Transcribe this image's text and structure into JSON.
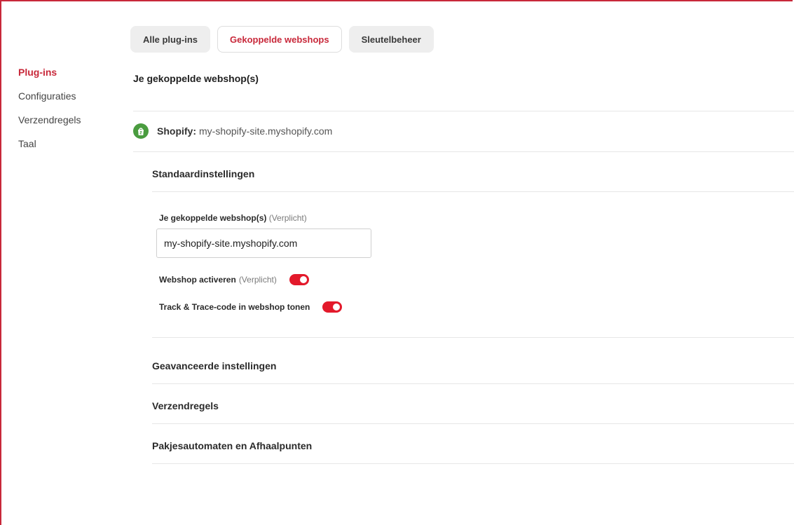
{
  "tabs": [
    {
      "label": "Alle plug-ins",
      "active": false
    },
    {
      "label": "Gekoppelde webshops",
      "active": true
    },
    {
      "label": "Sleutelbeheer",
      "active": false
    }
  ],
  "sidebar": {
    "items": [
      {
        "label": "Plug-ins",
        "active": true
      },
      {
        "label": "Configuraties",
        "active": false
      },
      {
        "label": "Verzendregels",
        "active": false
      },
      {
        "label": "Taal",
        "active": false
      }
    ]
  },
  "main": {
    "title": "Je gekoppelde webshop(s)",
    "shop": {
      "platform": "Shopify:",
      "domain": "my-shopify-site.myshopify.com",
      "icon": "shopify-bag-icon"
    },
    "default_settings": {
      "title": "Standaardinstellingen",
      "webshop_field": {
        "label": "Je gekoppelde webshop(s)",
        "required": "(Verplicht)",
        "value": "my-shopify-site.myshopify.com"
      },
      "activate_toggle": {
        "label": "Webshop activeren",
        "required": "(Verplicht)",
        "on": true
      },
      "track_trace_toggle": {
        "label": "Track & Trace-code in webshop tonen",
        "on": true
      }
    },
    "sections": [
      "Geavanceerde instellingen",
      "Verzendregels",
      "Pakjesautomaten en Afhaalpunten"
    ]
  },
  "colors": {
    "accent": "#c8283a",
    "toggle_on": "#e3192b",
    "shopify_green": "#4a9c3f"
  }
}
